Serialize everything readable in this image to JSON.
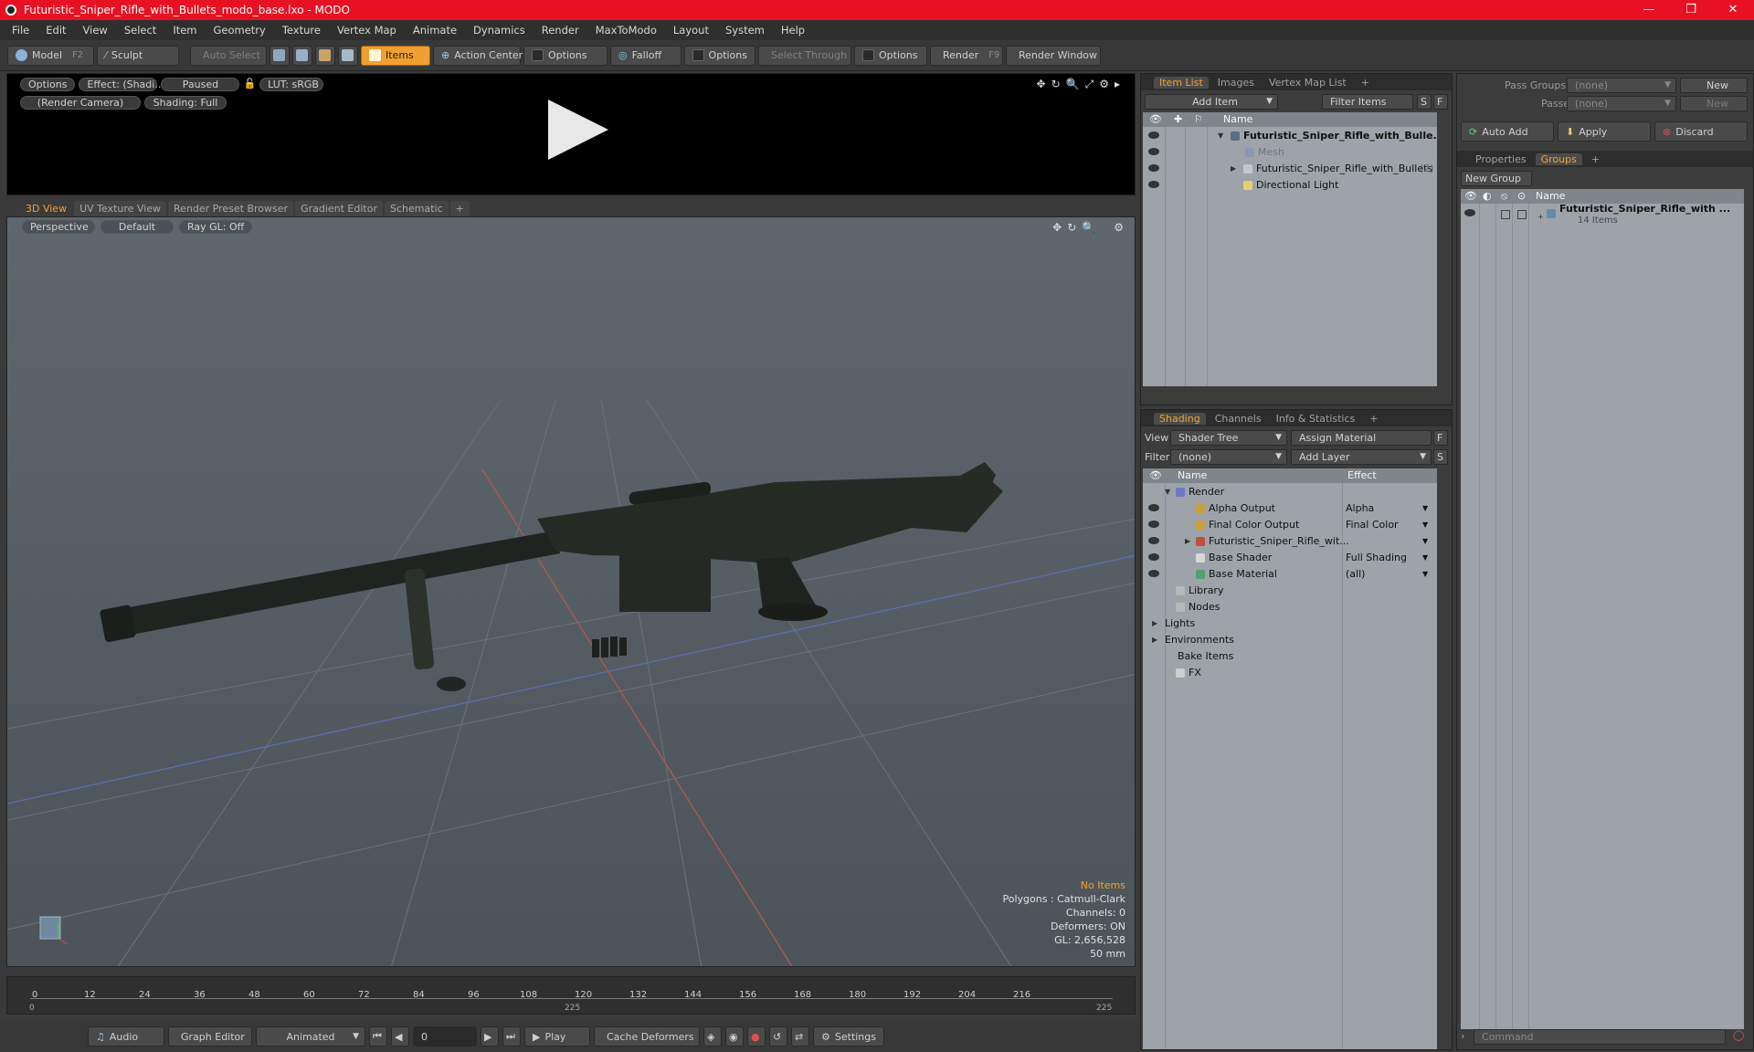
{
  "window": {
    "title": "Futuristic_Sniper_Rifle_with_Bullets_modo_base.lxo - MODO",
    "minimize": "—",
    "maximize": "❐",
    "close": "✕"
  },
  "menu": [
    "File",
    "Edit",
    "View",
    "Select",
    "Item",
    "Geometry",
    "Texture",
    "Vertex Map",
    "Animate",
    "Dynamics",
    "Render",
    "MaxToModo",
    "Layout",
    "System",
    "Help"
  ],
  "toolbar": {
    "model": "Model",
    "model_key": "F2",
    "sculpt": "Sculpt",
    "auto_select": "Auto Select",
    "items": "Items",
    "action_center": "Action Center",
    "options1": "Options",
    "falloff": "Falloff",
    "options2": "Options",
    "select_through": "Select Through",
    "options3": "Options",
    "render": "Render",
    "render_key": "F9",
    "render_window": "Render Window"
  },
  "preview": {
    "options": "Options",
    "effect": "Effect: (Shadi...",
    "paused": "Paused",
    "lut": "LUT: sRGB",
    "camera": "(Render Camera)",
    "shading": "Shading: Full"
  },
  "view_tabs": [
    "3D View",
    "UV Texture View",
    "Render Preset Browser",
    "Gradient Editor",
    "Schematic",
    "+"
  ],
  "viewport": {
    "perspective": "Perspective",
    "default": "Default",
    "raygl": "Ray GL: Off",
    "stats": [
      "No Items",
      "Polygons : Catmull-Clark",
      "Channels: 0",
      "Deformers: ON",
      "GL: 2,656,528",
      "50 mm"
    ]
  },
  "timeline": {
    "ticks": [
      "0",
      "12",
      "24",
      "36",
      "48",
      "60",
      "72",
      "84",
      "96",
      "108",
      "120",
      "132",
      "144",
      "156",
      "168",
      "180",
      "192",
      "204",
      "216"
    ],
    "start": "0",
    "mid": "225",
    "end": "225"
  },
  "bottom": {
    "audio": "Audio",
    "graph_editor": "Graph Editor",
    "animated": "Animated",
    "frame": "0",
    "play": "Play",
    "cache": "Cache Deformers",
    "settings": "Settings"
  },
  "item_list": {
    "tabs": [
      "Item List",
      "Images",
      "Vertex Map List",
      "+"
    ],
    "add_item": "Add Item",
    "filter": "Filter Items",
    "s": "S",
    "f": "F",
    "col_name": "Name",
    "rows": [
      {
        "label": "Futuristic_Sniper_Rifle_with_Bulle...",
        "bold": true
      },
      {
        "label": "Mesh",
        "dim": true
      },
      {
        "label": "Futuristic_Sniper_Rifle_with_Bullets",
        "suffix": "(2)"
      },
      {
        "label": "Directional Light"
      }
    ]
  },
  "shading": {
    "tabs": [
      "Shading",
      "Channels",
      "Info & Statistics",
      "+"
    ],
    "view_label": "View",
    "view_value": "Shader Tree",
    "assign": "Assign Material",
    "f": "F",
    "filter_label": "Filter",
    "filter_value": "(none)",
    "add_layer": "Add Layer",
    "s": "S",
    "col_name": "Name",
    "col_effect": "Effect",
    "rows": [
      {
        "label": "Render",
        "effect": ""
      },
      {
        "label": "Alpha Output",
        "effect": "Alpha"
      },
      {
        "label": "Final Color Output",
        "effect": "Final Color"
      },
      {
        "label": "Futuristic_Sniper_Rifle_wit...",
        "effect": ""
      },
      {
        "label": "Base Shader",
        "effect": "Full Shading"
      },
      {
        "label": "Base Material",
        "effect": "(all)"
      },
      {
        "label": "Library",
        "effect": ""
      },
      {
        "label": "Nodes",
        "effect": ""
      },
      {
        "label": "Lights",
        "effect": ""
      },
      {
        "label": "Environments",
        "effect": ""
      },
      {
        "label": "Bake Items",
        "effect": ""
      },
      {
        "label": "FX",
        "effect": ""
      }
    ]
  },
  "groups": {
    "pass_groups": "Pass Groups",
    "pass_groups_value": "(none)",
    "new": "New",
    "passes": "Passes",
    "passes_value": "(none)",
    "new2": "New",
    "auto_add": "Auto Add",
    "apply": "Apply",
    "discard": "Discard",
    "tabs": [
      "Properties",
      "Groups",
      "+"
    ],
    "new_group": "New Group",
    "col_name": "Name",
    "group_name": "Futuristic_Sniper_Rifle_with ...",
    "group_count": "14 Items"
  },
  "command": {
    "placeholder": "Command"
  }
}
